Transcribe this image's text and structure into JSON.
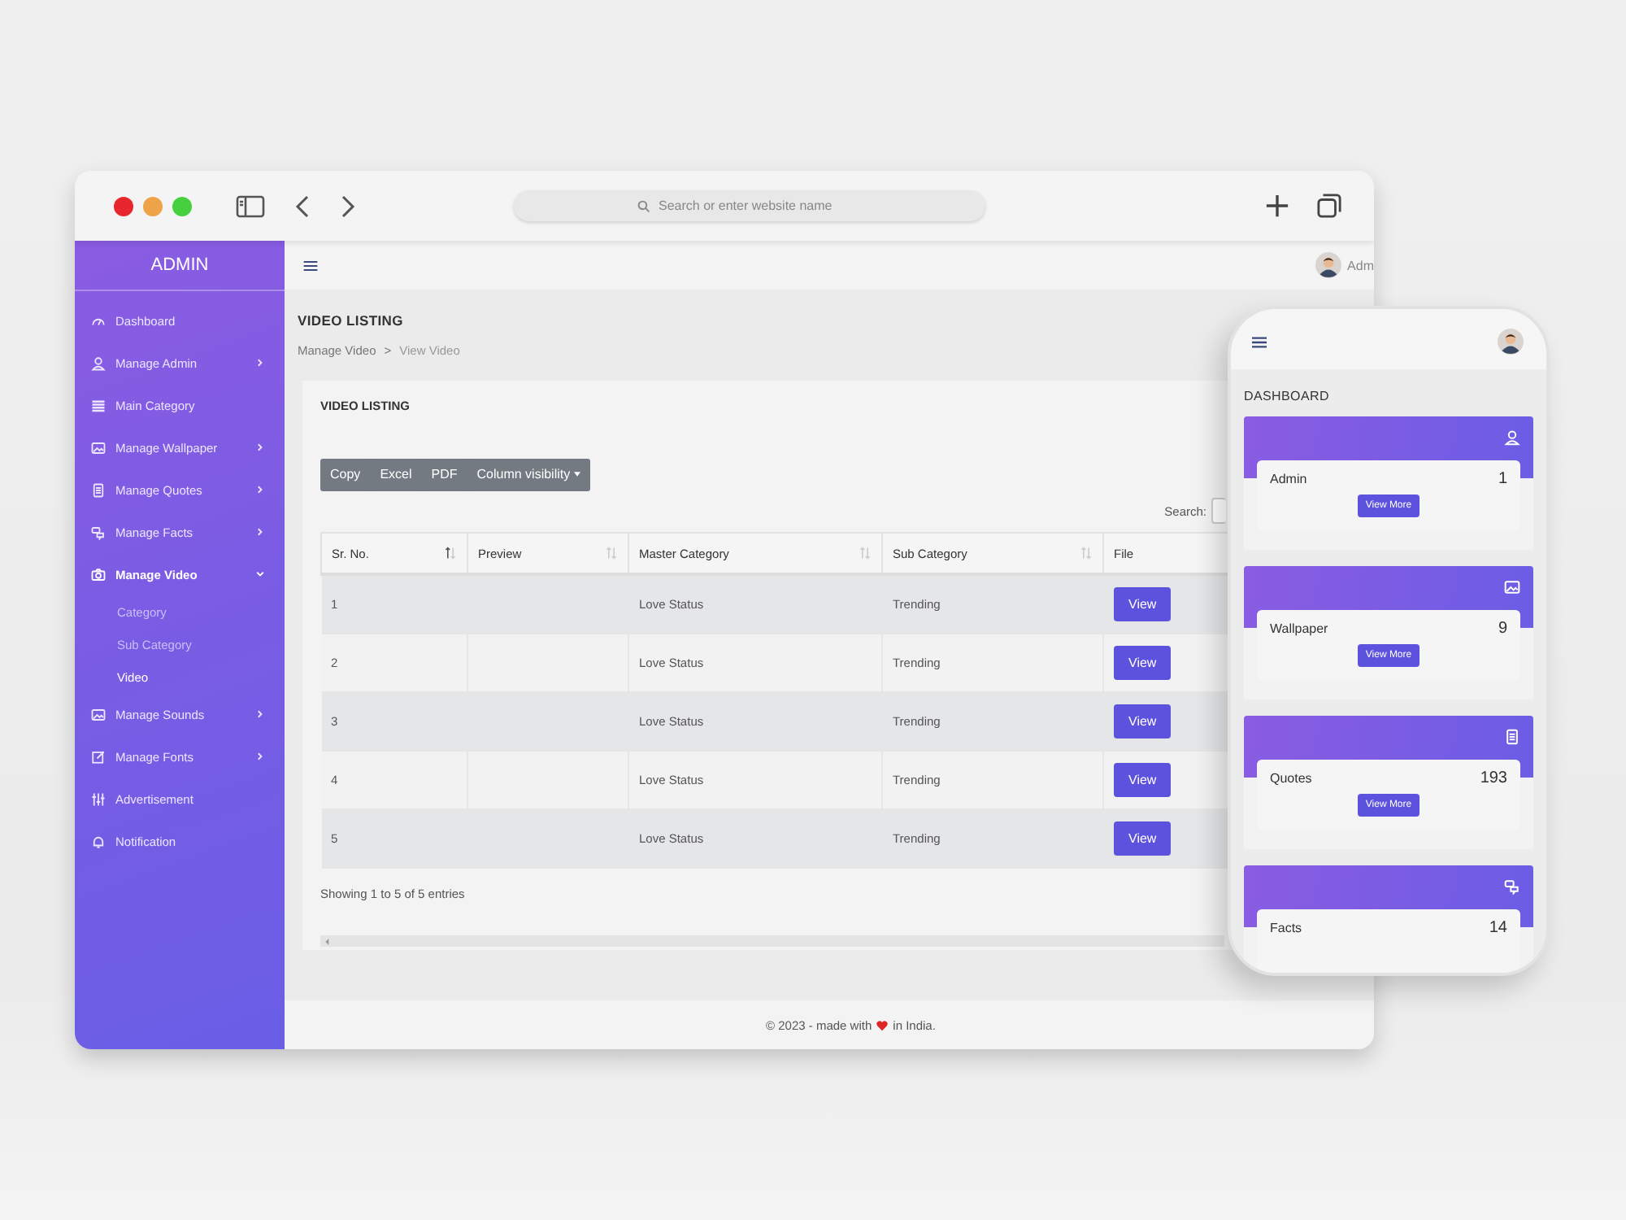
{
  "browser": {
    "address_placeholder": "Search or enter website name"
  },
  "sidebar": {
    "title": "ADMIN",
    "items": [
      {
        "label": "Dashboard",
        "expandable": false,
        "selected": false
      },
      {
        "label": "Manage Admin",
        "expandable": true,
        "expanded": false,
        "selected": false
      },
      {
        "label": "Main Category",
        "expandable": false,
        "selected": false
      },
      {
        "label": "Manage Wallpaper",
        "expandable": true,
        "expanded": false,
        "selected": false
      },
      {
        "label": "Manage Quotes",
        "expandable": true,
        "expanded": false,
        "selected": false
      },
      {
        "label": "Manage Facts",
        "expandable": true,
        "expanded": false,
        "selected": false
      },
      {
        "label": "Manage Video",
        "expandable": true,
        "expanded": true,
        "selected": true,
        "children": [
          {
            "label": "Category",
            "selected": false
          },
          {
            "label": "Sub Category",
            "selected": false
          },
          {
            "label": "Video",
            "selected": true
          }
        ]
      },
      {
        "label": "Manage Sounds",
        "expandable": true,
        "expanded": false,
        "selected": false
      },
      {
        "label": "Manage Fonts",
        "expandable": true,
        "expanded": false,
        "selected": false
      },
      {
        "label": "Advertisement",
        "expandable": false,
        "selected": false
      },
      {
        "label": "Notification",
        "expandable": false,
        "selected": false
      }
    ]
  },
  "topbar": {
    "user_label": "Adm"
  },
  "page": {
    "title": "VIDEO LISTING",
    "breadcrumb": [
      "Manage Video",
      "View Video"
    ],
    "breadcrumb_separator": ">"
  },
  "card": {
    "title": "VIDEO LISTING",
    "export_buttons": [
      {
        "label": "Copy",
        "dropdown": false
      },
      {
        "label": "Excel",
        "dropdown": false
      },
      {
        "label": "PDF",
        "dropdown": false
      },
      {
        "label": "Column visibility",
        "dropdown": true
      }
    ],
    "search_label": "Search:",
    "table": {
      "columns": [
        {
          "label": "Sr. No.",
          "sortable": true,
          "sorted_ascending": true
        },
        {
          "label": "Preview",
          "sortable": true,
          "sorted_ascending": false
        },
        {
          "label": "Master Category",
          "sortable": true,
          "sorted_ascending": false
        },
        {
          "label": "Sub Category",
          "sortable": true,
          "sorted_ascending": false
        },
        {
          "label": "File",
          "sortable": false
        }
      ],
      "rows": [
        {
          "sr": "1",
          "master_category": "Love Status",
          "sub_category": "Trending",
          "file_button": "View"
        },
        {
          "sr": "2",
          "master_category": "Love Status",
          "sub_category": "Trending",
          "file_button": "View"
        },
        {
          "sr": "3",
          "master_category": "Love Status",
          "sub_category": "Trending",
          "file_button": "View"
        },
        {
          "sr": "4",
          "master_category": "Love Status",
          "sub_category": "Trending",
          "file_button": "View"
        },
        {
          "sr": "5",
          "master_category": "Love Status",
          "sub_category": "Trending",
          "file_button": "View"
        }
      ]
    },
    "info": "Showing 1 to 5 of 5 entries"
  },
  "footer": {
    "before": "© 2023 - made with",
    "after": "in India."
  },
  "phone": {
    "title": "DASHBOARD",
    "cards": [
      {
        "label": "Admin",
        "count": "1",
        "button": "View More"
      },
      {
        "label": "Wallpaper",
        "count": "9",
        "button": "View More"
      },
      {
        "label": "Quotes",
        "count": "193",
        "button": "View More"
      },
      {
        "label": "Facts",
        "count": "14"
      }
    ]
  }
}
